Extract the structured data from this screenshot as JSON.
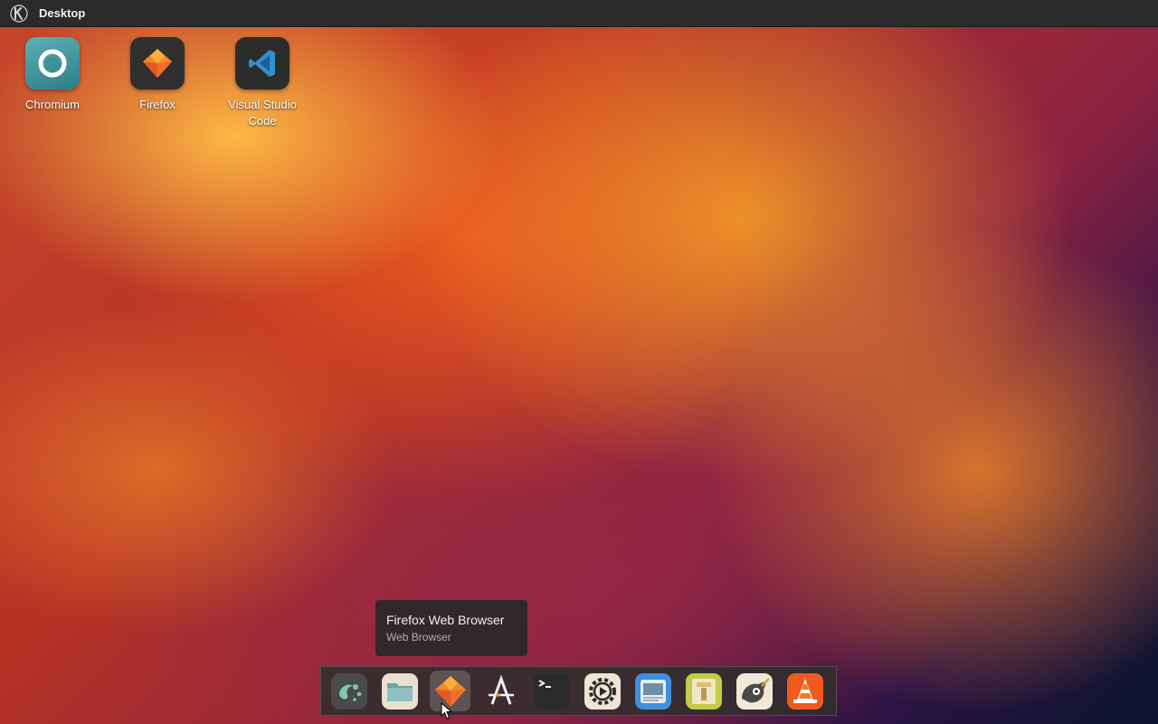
{
  "panel": {
    "title": "Desktop",
    "logo_icon": "kde-logo-icon"
  },
  "desktop_icons": [
    {
      "label": "Chromium",
      "icon": "chromium-icon"
    },
    {
      "label": "Firefox",
      "icon": "firefox-icon"
    },
    {
      "label": "Visual Studio Code",
      "icon": "vscode-icon"
    }
  ],
  "tooltip": {
    "title": "Firefox Web Browser",
    "subtitle": "Web Browser"
  },
  "dock": {
    "items": [
      {
        "name": "launcher",
        "icon": "app-launcher-icon"
      },
      {
        "name": "files",
        "icon": "file-manager-icon"
      },
      {
        "name": "firefox",
        "icon": "firefox-icon",
        "active": true
      },
      {
        "name": "text-editor",
        "icon": "text-editor-icon"
      },
      {
        "name": "terminal",
        "icon": "terminal-icon"
      },
      {
        "name": "settings",
        "icon": "settings-gear-icon"
      },
      {
        "name": "image-viewer",
        "icon": "image-viewer-icon"
      },
      {
        "name": "archive-manager",
        "icon": "archive-icon"
      },
      {
        "name": "gimp",
        "icon": "gimp-icon"
      },
      {
        "name": "vlc",
        "icon": "vlc-icon"
      }
    ]
  },
  "colors": {
    "panel_bg": "#2a2a2a",
    "dock_bg": "#302e2e",
    "tooltip_bg": "#2a2828"
  }
}
